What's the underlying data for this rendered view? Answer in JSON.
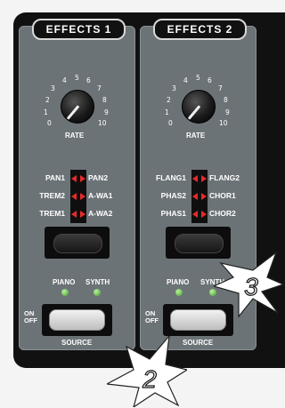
{
  "effects1": {
    "title": "EFFECTS 1",
    "scale": [
      "0",
      "1",
      "2",
      "3",
      "4",
      "5",
      "6",
      "7",
      "8",
      "9",
      "10"
    ],
    "rate_label": "RATE",
    "rows": [
      {
        "left": "PAN1",
        "right": "PAN2"
      },
      {
        "left": "TREM2",
        "right": "A-WA1"
      },
      {
        "left": "TREM1",
        "right": "A-WA2"
      }
    ],
    "piano_label": "PIANO",
    "synth_label": "SYNTH",
    "on_label": "ON",
    "off_label": "OFF",
    "source_label": "SOURCE"
  },
  "effects2": {
    "title": "EFFECTS 2",
    "scale": [
      "0",
      "1",
      "2",
      "3",
      "4",
      "5",
      "6",
      "7",
      "8",
      "9",
      "10"
    ],
    "rate_label": "RATE",
    "rows": [
      {
        "left": "FLANG1",
        "right": "FLANG2"
      },
      {
        "left": "PHAS2",
        "right": "CHOR1"
      },
      {
        "left": "PHAS1",
        "right": "CHOR2"
      }
    ],
    "piano_label": "PIANO",
    "synth_label": "SYNTH",
    "on_label": "ON",
    "off_label": "OFF",
    "source_label": "SOURCE"
  },
  "callouts": {
    "two": "2",
    "three": "3"
  },
  "colors": {
    "panel": "#6c7377",
    "led_red": "#e62b2b",
    "led_green": "#3d9a2d",
    "chassis": "#111111"
  }
}
